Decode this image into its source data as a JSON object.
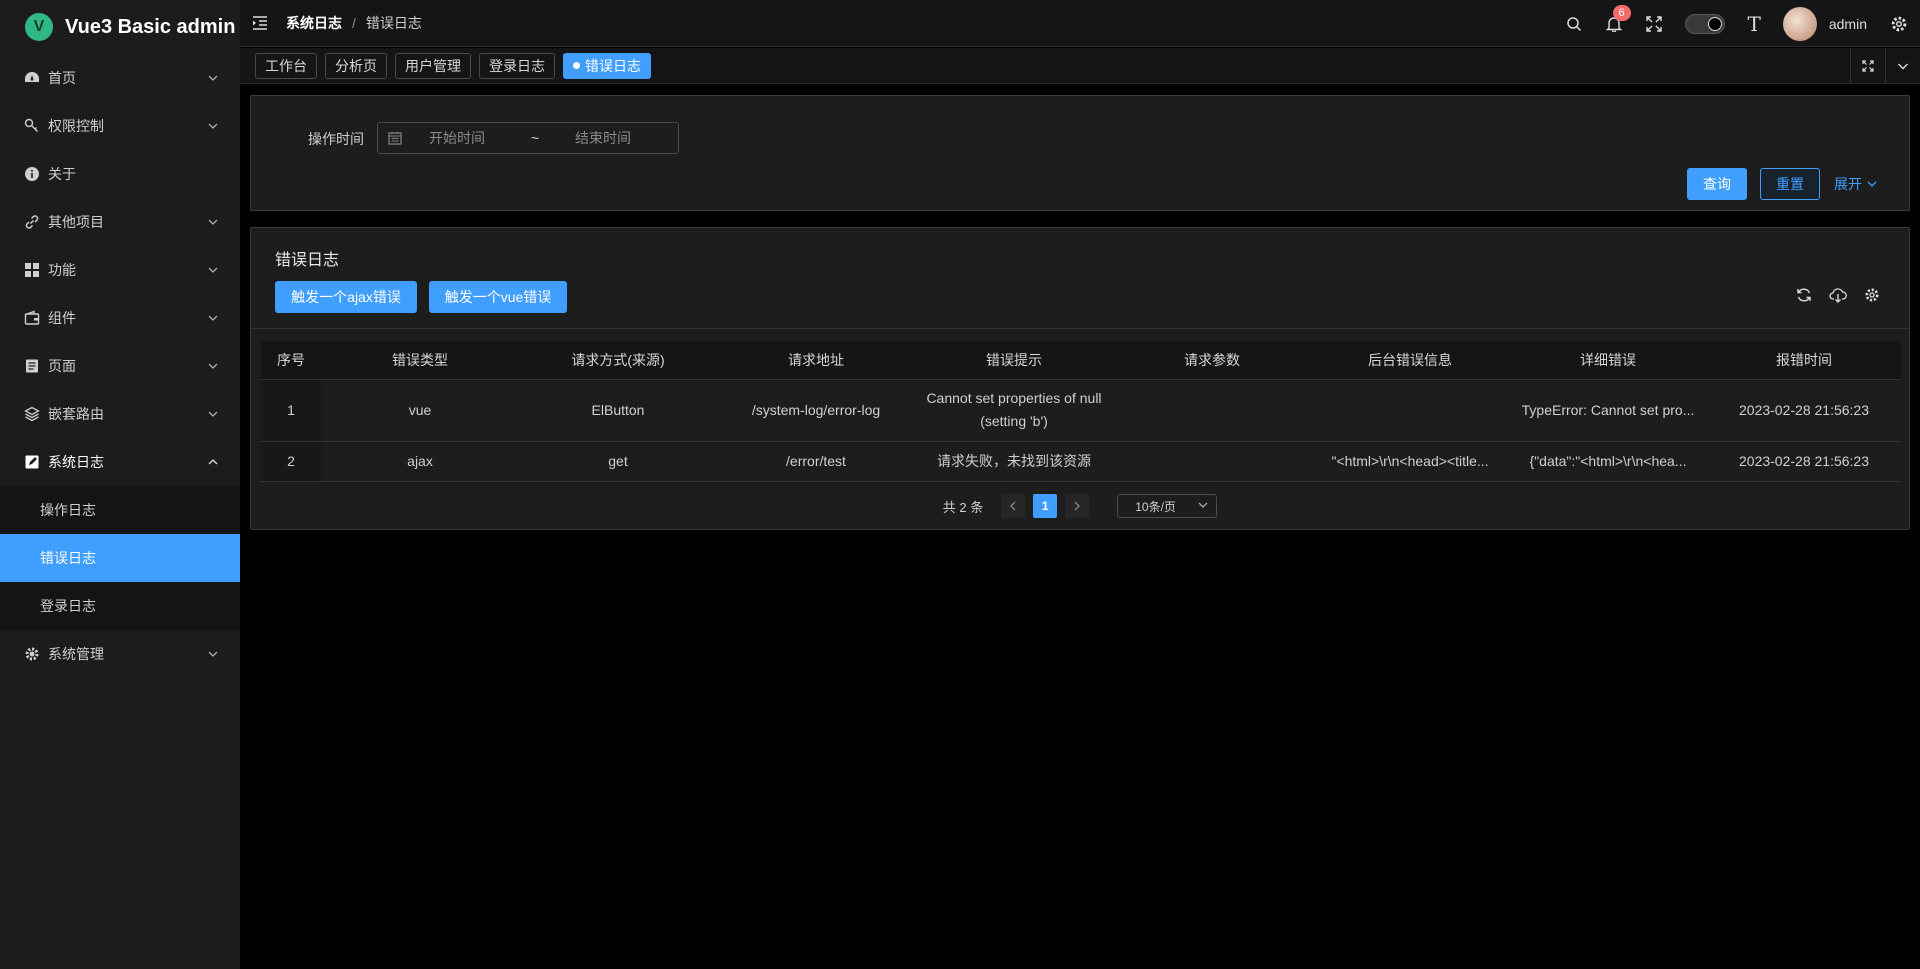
{
  "app": {
    "title": "Vue3 Basic admin"
  },
  "sidebar": {
    "items": [
      {
        "label": "首页",
        "icon": "dashboard-icon"
      },
      {
        "label": "权限控制",
        "icon": "key-icon"
      },
      {
        "label": "关于",
        "icon": "info-icon"
      },
      {
        "label": "其他项目",
        "icon": "link-icon"
      },
      {
        "label": "功能",
        "icon": "apps-icon"
      },
      {
        "label": "组件",
        "icon": "wallet-icon"
      },
      {
        "label": "页面",
        "icon": "page-icon"
      },
      {
        "label": "嵌套路由",
        "icon": "layers-icon"
      },
      {
        "label": "系统日志",
        "icon": "edit-icon"
      },
      {
        "label": "系统管理",
        "icon": "gear-icon"
      }
    ],
    "sub_items": [
      "操作日志",
      "错误日志",
      "登录日志"
    ]
  },
  "header": {
    "breadcrumb": [
      "系统日志",
      "错误日志"
    ],
    "breadcrumb_sep": "/",
    "notification_count": "6",
    "font_icon_label": "T",
    "user": "admin"
  },
  "tabs": [
    "工作台",
    "分析页",
    "用户管理",
    "登录日志",
    "错误日志"
  ],
  "search": {
    "label": "操作时间",
    "start_placeholder": "开始时间",
    "range_sep": "~",
    "end_placeholder": "结束时间",
    "query": "查询",
    "reset": "重置",
    "expand": "展开"
  },
  "table": {
    "title": "错误日志",
    "btn_ajax": "触发一个ajax错误",
    "btn_vue": "触发一个vue错误",
    "columns": [
      "序号",
      "错误类型",
      "请求方式(来源)",
      "请求地址",
      "错误提示",
      "请求参数",
      "后台错误信息",
      "详细错误",
      "报错时间"
    ],
    "rows": [
      [
        "1",
        "vue",
        "ElButton",
        "/system-log/error-log",
        "Cannot set properties of null (setting 'b')",
        "",
        "",
        "TypeError: Cannot set pro...",
        "2023-02-28 21:56:23"
      ],
      [
        "2",
        "ajax",
        "get",
        "/error/test",
        "请求失败，未找到该资源",
        "",
        "\"<html>\\r\\n<head><title...",
        "{\"data\":\"<html>\\r\\n<hea...",
        "2023-02-28 21:56:23"
      ]
    ]
  },
  "pagination": {
    "total": "共 2 条",
    "current": "1",
    "page_size": "10条/页"
  },
  "colors": {
    "accent": "#409eff",
    "sidebar_bg": "#1c1c1c",
    "panel_bg": "#1d1d1d",
    "badge": "#f56c6c",
    "logo": "#2fb884"
  }
}
